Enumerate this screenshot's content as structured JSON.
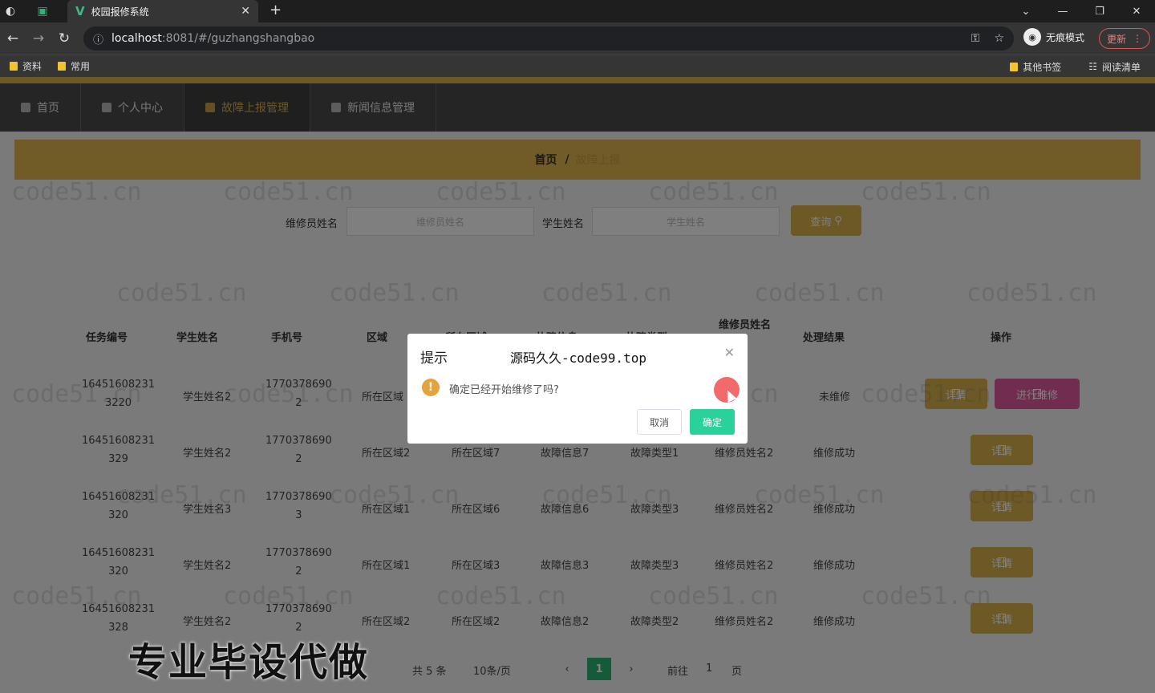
{
  "browser": {
    "tab_title": "校园报修系统",
    "url_host": "localhost",
    "url_path": ":8081/#/guzhangshangbao",
    "profile_label": "无痕模式",
    "update_label": "更新",
    "bookmarks": [
      "资料",
      "常用"
    ],
    "bookmarks_right": [
      "其他书签",
      "阅读清单"
    ]
  },
  "nav": {
    "items": [
      {
        "label": "首页",
        "icon": "home-icon"
      },
      {
        "label": "个人中心",
        "icon": "user-icon"
      },
      {
        "label": "故障上报管理",
        "icon": "report-icon"
      },
      {
        "label": "新闻信息管理",
        "icon": "news-icon"
      }
    ],
    "active_index": 2
  },
  "breadcrumb": {
    "home": "首页",
    "sep": "/",
    "current": "故障上报"
  },
  "search": {
    "repairer_label": "维修员姓名",
    "repairer_placeholder": "维修员姓名",
    "student_label": "学生姓名",
    "student_placeholder": "学生姓名",
    "query_label": "查询"
  },
  "table": {
    "headers": [
      "任务编号",
      "学生姓名",
      "手机号",
      "区域",
      "所在区域",
      "故障信息",
      "故障类型",
      "维修员姓名",
      "处理结果",
      "操作"
    ],
    "rows": [
      {
        "id_1": "16451608231",
        "id_2": "3220",
        "student": "学生姓名2",
        "phone_1": "1770378690",
        "phone_2": "2",
        "area": "所在区域",
        "location": "",
        "fault": "",
        "type": "",
        "repairer": "",
        "result": "未维修",
        "detail": "详情",
        "repair": "进行维修"
      },
      {
        "id_1": "16451608231",
        "id_2": "329",
        "student": "学生姓名2",
        "phone_1": "1770378690",
        "phone_2": "2",
        "area": "所在区域2",
        "location": "所在区域7",
        "fault": "故障信息7",
        "type": "故障类型1",
        "repairer": "维修员姓名2",
        "result": "维修成功",
        "detail": "详情"
      },
      {
        "id_1": "16451608231",
        "id_2": "320",
        "student": "学生姓名3",
        "phone_1": "1770378690",
        "phone_2": "3",
        "area": "所在区域1",
        "location": "所在区域6",
        "fault": "故障信息6",
        "type": "故障类型3",
        "repairer": "维修员姓名2",
        "result": "维修成功",
        "detail": "详情"
      },
      {
        "id_1": "16451608231",
        "id_2": "320",
        "student": "学生姓名2",
        "phone_1": "1770378690",
        "phone_2": "2",
        "area": "所在区域1",
        "location": "所在区域3",
        "fault": "故障信息3",
        "type": "故障类型3",
        "repairer": "维修员姓名2",
        "result": "维修成功",
        "detail": "详情"
      },
      {
        "id_1": "16451608231",
        "id_2": "328",
        "student": "学生姓名2",
        "phone_1": "1770378690",
        "phone_2": "2",
        "area": "所在区域2",
        "location": "所在区域2",
        "fault": "故障信息2",
        "type": "故障类型2",
        "repairer": "维修员姓名2",
        "result": "维修成功",
        "detail": "详情"
      }
    ]
  },
  "pagination": {
    "total": "共 5 条",
    "page_size": "10条/页",
    "current_page": "1",
    "goto_label": "前往",
    "goto_value": "1",
    "page_suffix": "页"
  },
  "dialog": {
    "title": "提示",
    "subtitle": "源码久久-code99.top",
    "message": "确定已经开始维修了吗?",
    "cancel": "取消",
    "confirm": "确定"
  },
  "watermark_text": "code51.cn",
  "promo_text": "专业毕设代做",
  "colors": {
    "accent": "#d9b24a",
    "confirm": "#2bd19a",
    "repair": "#e05aa0",
    "page_active": "#2bb673"
  }
}
